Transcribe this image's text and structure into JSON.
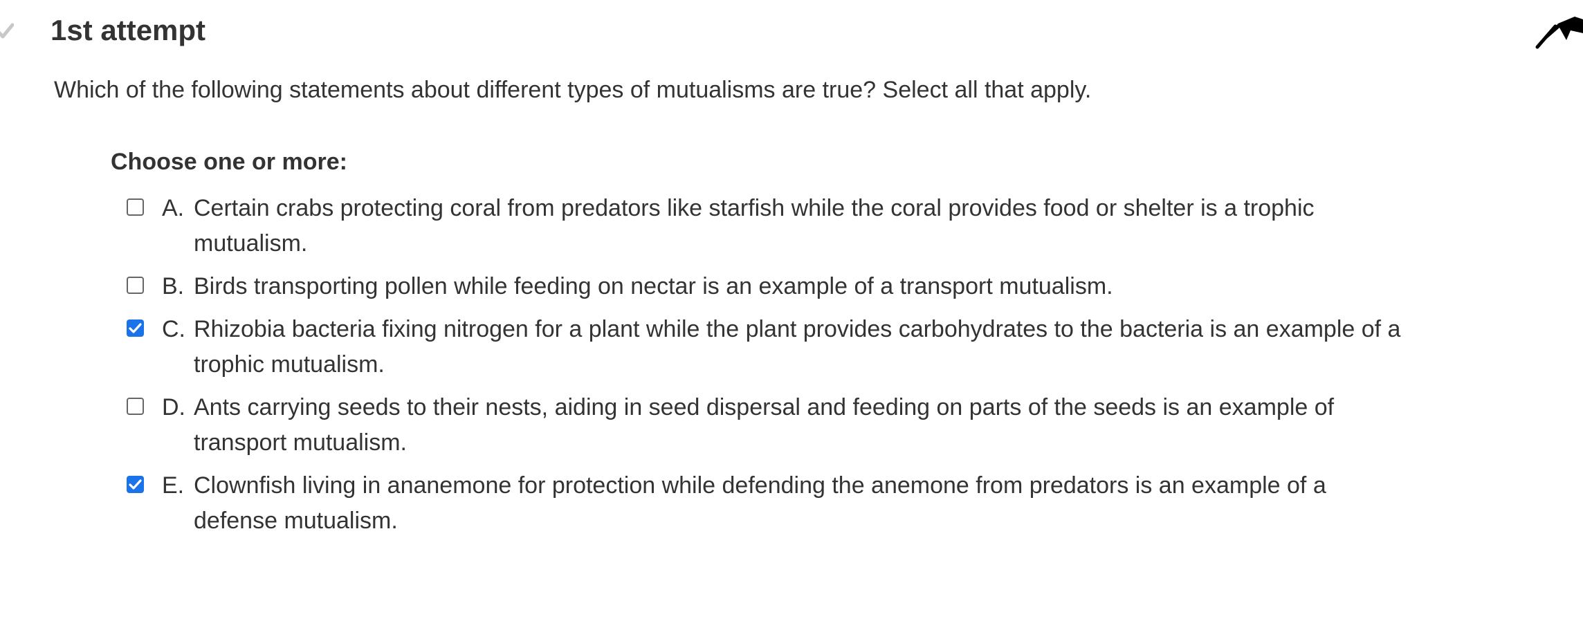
{
  "attempt": {
    "title": "1st attempt",
    "status_icon": "check-icon"
  },
  "cursor_icon": "cursor-arrow-icon",
  "question": {
    "text": "Which of the following statements about different types of mutualisms are true? Select all that apply.",
    "instruction": "Choose one or more:"
  },
  "options": [
    {
      "letter": "A.",
      "text": "Certain crabs protecting coral from predators like starfish while the coral provides food or shelter is a trophic mutualism.",
      "checked": false
    },
    {
      "letter": "B.",
      "text": "Birds transporting pollen while feeding on nectar is an example of a transport mutualism.",
      "checked": false
    },
    {
      "letter": "C.",
      "text": "Rhizobia bacteria fixing nitrogen for a plant while the plant provides carbohydrates to the bacteria is an example of a trophic mutualism.",
      "checked": true
    },
    {
      "letter": "D.",
      "text": "Ants carrying seeds to their nests, aiding in seed dispersal and feeding on parts of the seeds is an example of transport mutualism.",
      "checked": false
    },
    {
      "letter": "E.",
      "text": "Clownfish living in ananemone for protection while defending the anemone from predators is an example of a defense mutualism.",
      "checked": true
    }
  ],
  "colors": {
    "checkbox_checked": "#1a73e8",
    "text": "#333333",
    "status_check": "#c8c8c8"
  }
}
